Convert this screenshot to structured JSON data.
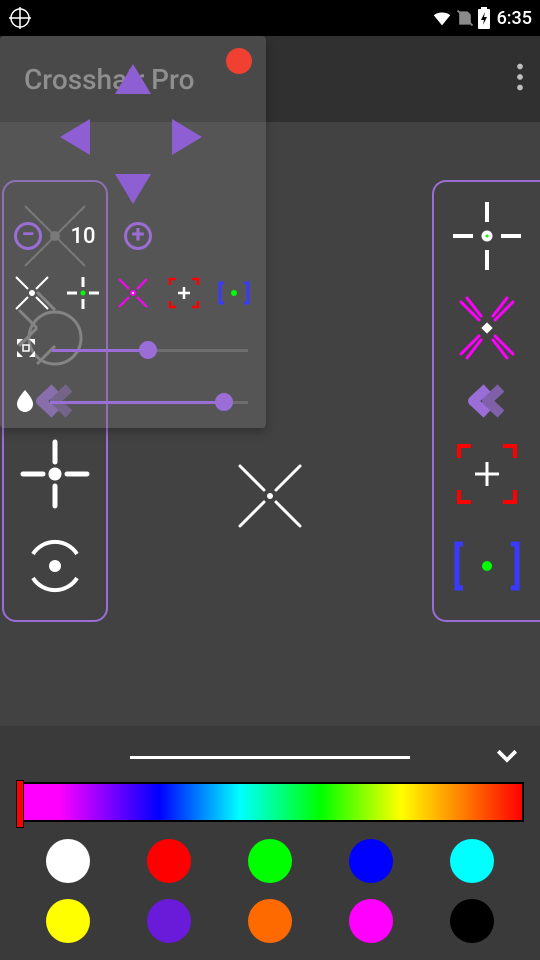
{
  "status": {
    "time": "6:35"
  },
  "app": {
    "title": "Crosshair Pro"
  },
  "control": {
    "size_value": "10",
    "slider1_pct": 49,
    "slider2_pct": 88
  },
  "colors": {
    "swatches": [
      "#ffffff",
      "#ff0000",
      "#00ff00",
      "#0000ff",
      "#00ffff",
      "#ffff00",
      "#6a1bd9",
      "#ff6a00",
      "#ff00ff",
      "#000000"
    ]
  }
}
